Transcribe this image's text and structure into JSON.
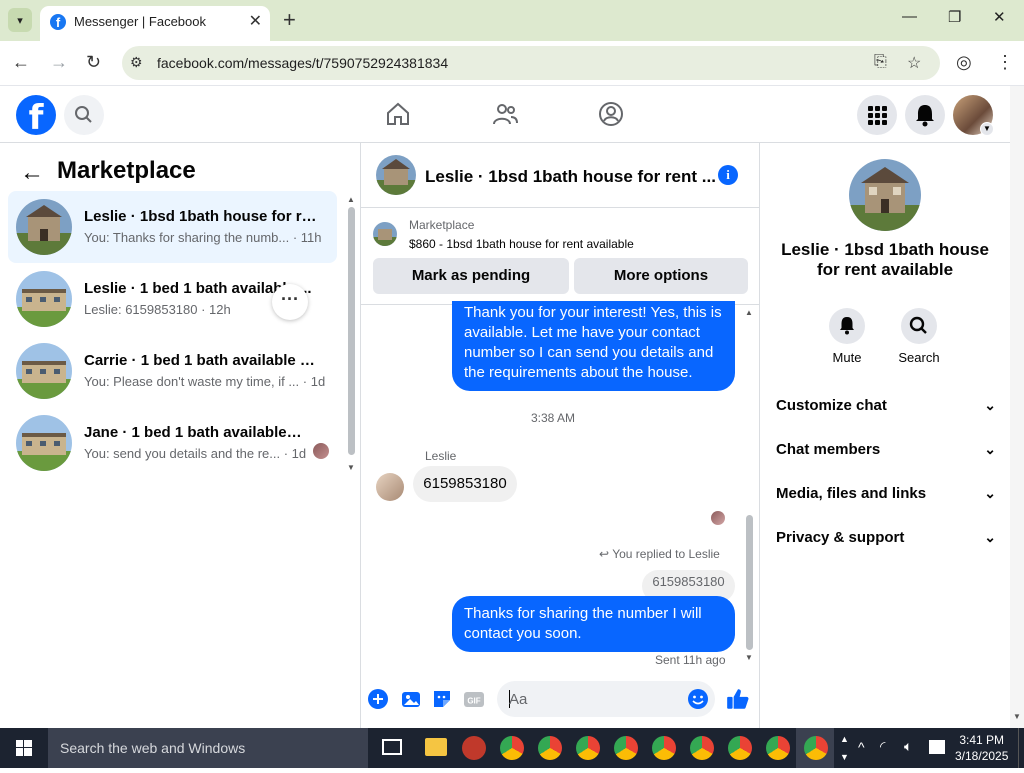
{
  "browser": {
    "tab_title": "Messenger | Facebook",
    "url": "facebook.com/messages/t/7590752924381834"
  },
  "left_panel": {
    "title": "Marketplace",
    "conversations": [
      {
        "name": "Leslie · 1bsd 1bath house for ren...",
        "preview": "You: Thanks for sharing the numb... · 11h",
        "active": true
      },
      {
        "name": "Leslie · 1 bed 1 bath available ...",
        "preview": "Leslie: 6159853180 · 12h",
        "active": false
      },
      {
        "name": "Carrie · 1 bed 1 bath available ho...",
        "preview": "You: Please don't waste my time, if ... · 1d",
        "active": false
      },
      {
        "name": "Jane · 1 bed 1 bath available h...",
        "preview": "You: send you details and the re... · 1d",
        "active": false
      }
    ]
  },
  "chat": {
    "title": "Leslie · 1bsd 1bath house for rent ...",
    "listing_category": "Marketplace",
    "listing_title": "$860 - 1bsd 1bath house for rent available",
    "mark_pending_label": "Mark as pending",
    "more_options_label": "More options",
    "messages": {
      "out1": "Thank you for your interest! Yes, this is available. Let me have your contact number so I can send you details and the requirements about the house.",
      "timestamp": "3:38 AM",
      "sender": "Leslie",
      "in1": "6159853180",
      "replied_label": "You replied to Leslie",
      "quoted": "6159853180",
      "out2": "Thanks for sharing the number I will contact you soon.",
      "sent_status": "Sent 11h ago"
    },
    "composer_placeholder": "Aa"
  },
  "right_panel": {
    "title": "Leslie · 1bsd 1bath house for rent available",
    "mute_label": "Mute",
    "search_label": "Search",
    "sections": [
      "Customize chat",
      "Chat members",
      "Media, files and links",
      "Privacy & support"
    ]
  },
  "taskbar": {
    "search_placeholder": "Search the web and Windows",
    "time": "3:41 PM",
    "date": "3/18/2025"
  },
  "colors": {
    "brand": "#0866ff",
    "active_conversation": "#ebf5ff",
    "browser_frame": "#dde9cf"
  }
}
